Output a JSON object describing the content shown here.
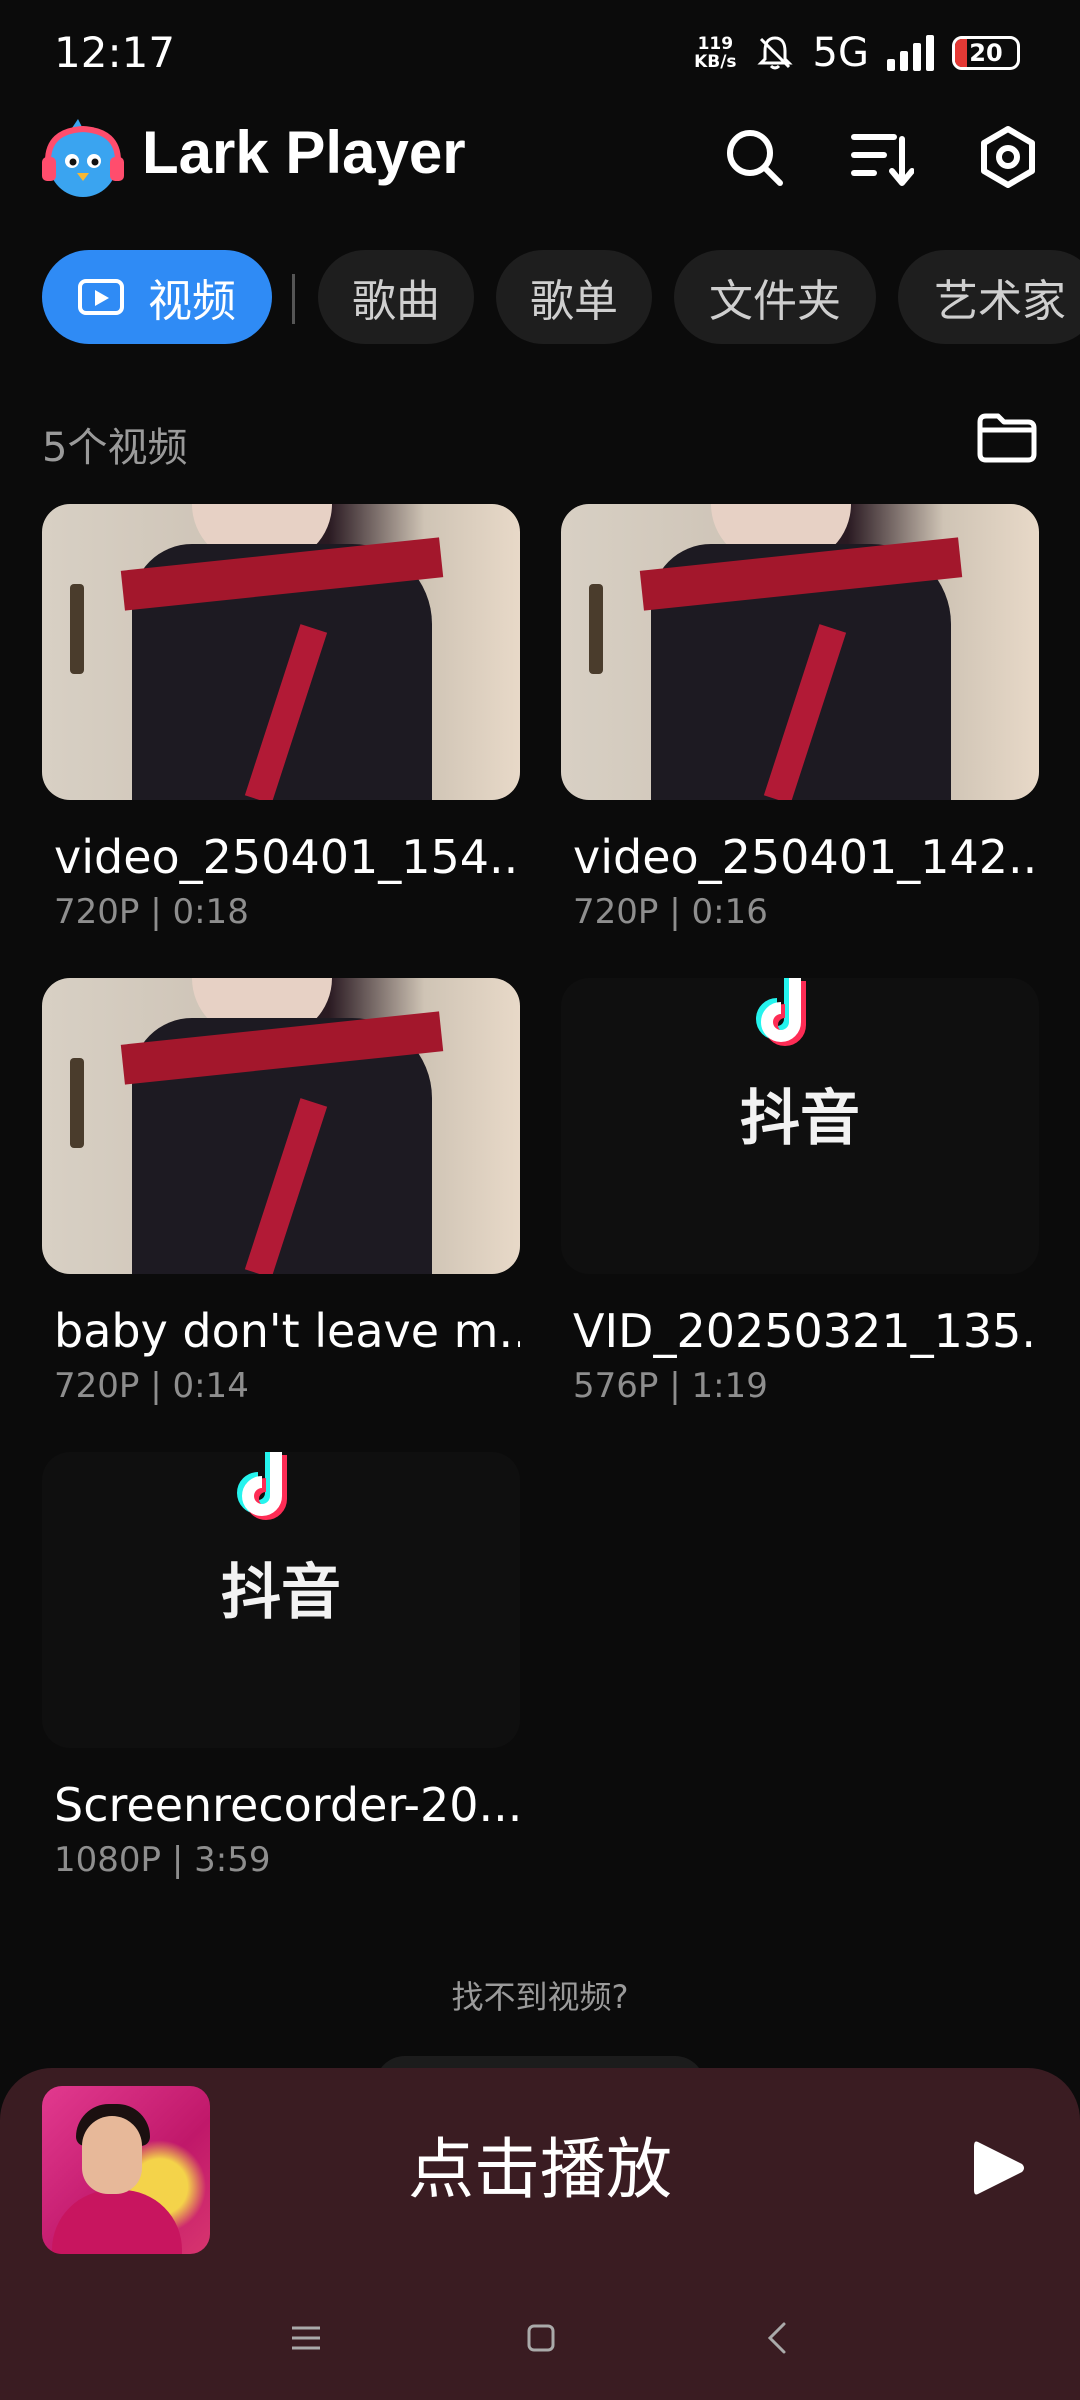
{
  "status_bar": {
    "time": "12:17",
    "net_speed_top": "119",
    "net_speed_bottom": "KB/s",
    "network": "5G",
    "battery": "20",
    "battery_level": 0.2
  },
  "header": {
    "app_name": "Lark Player",
    "icons": [
      "search-icon",
      "sort-icon",
      "settings-icon"
    ]
  },
  "tabs": [
    {
      "label": "视频",
      "active": true
    },
    {
      "label": "歌曲",
      "active": false
    },
    {
      "label": "歌单",
      "active": false
    },
    {
      "label": "文件夹",
      "active": false
    },
    {
      "label": "艺术家",
      "active": false
    }
  ],
  "list": {
    "count_label": "5个视频"
  },
  "videos": [
    {
      "title": "video_250401_154...",
      "meta": "720P | 0:18",
      "thumb": "photo"
    },
    {
      "title": "video_250401_142...",
      "meta": "720P | 0:16",
      "thumb": "photo"
    },
    {
      "title": "baby don't leave m...",
      "meta": "720P | 0:14",
      "thumb": "photo"
    },
    {
      "title": "VID_20250321_135...",
      "meta": "576P | 1:19",
      "thumb": "douyin",
      "thumb_text": "抖音"
    },
    {
      "title": "Screenrecorder-20...",
      "meta": "1080P | 3:59",
      "thumb": "douyin",
      "thumb_text": "抖音"
    }
  ],
  "help": {
    "not_found": "找不到视频?"
  },
  "player": {
    "prompt": "点击播放"
  },
  "colors": {
    "accent": "#2f8bf5",
    "background": "#0b0b0b",
    "player_bg": "#3a1c22"
  }
}
